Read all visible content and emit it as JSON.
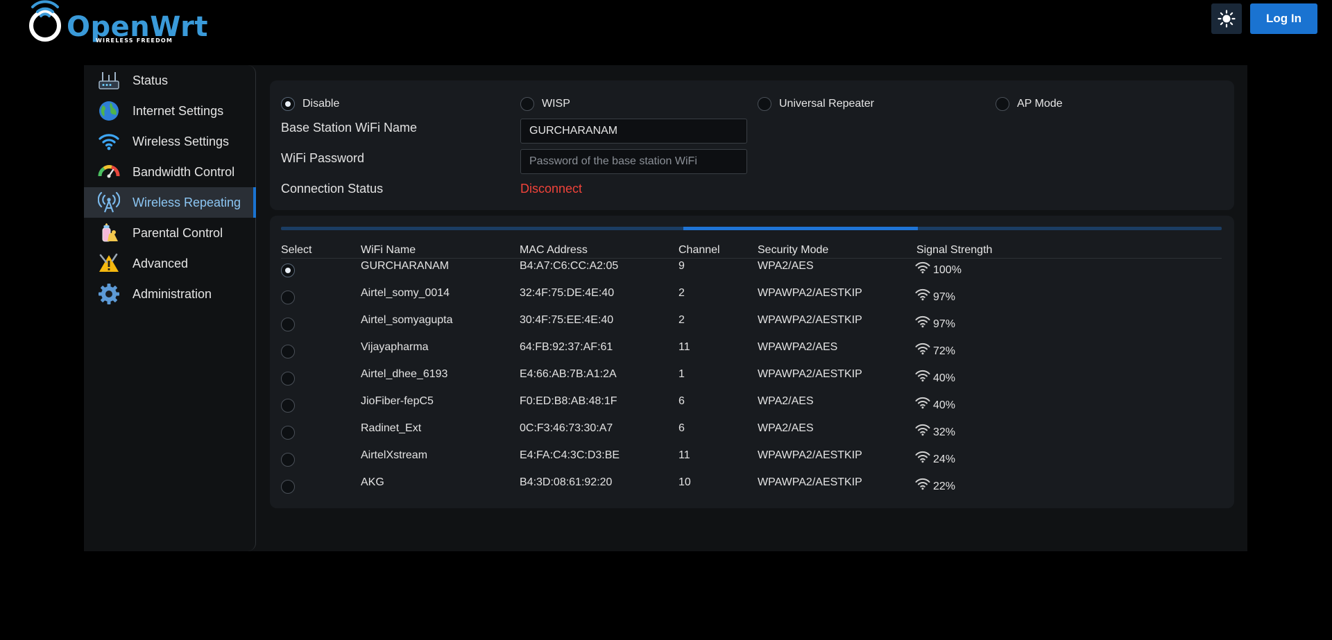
{
  "header": {
    "logo_text": "OpenWrt",
    "logo_tagline": "WIRELESS FREEDOM",
    "theme_icon": "sun-icon",
    "login_label": "Log In"
  },
  "colors": {
    "accent": "#1a73d1",
    "logo": "#3a9ad9",
    "error": "#f0433a",
    "active_nav_text": "#8cc6f3"
  },
  "sidebar": {
    "items": [
      {
        "label": "Status",
        "icon": "router-icon"
      },
      {
        "label": "Internet Settings",
        "icon": "globe-icon"
      },
      {
        "label": "Wireless Settings",
        "icon": "wifi-icon"
      },
      {
        "label": "Bandwidth Control",
        "icon": "speedometer-icon"
      },
      {
        "label": "Wireless Repeating",
        "icon": "antenna-icon",
        "active": true
      },
      {
        "label": "Parental Control",
        "icon": "baby-bottle-icon"
      },
      {
        "label": "Advanced",
        "icon": "warning-tools-icon"
      },
      {
        "label": "Administration",
        "icon": "gear-icon"
      }
    ]
  },
  "modes": {
    "selected": "Disable",
    "options": [
      "Disable",
      "WISP",
      "Universal Repeater",
      "AP Mode"
    ]
  },
  "form": {
    "ssid_label": "Base Station WiFi Name",
    "ssid_value": "GURCHARANAM",
    "password_label": "WiFi Password",
    "password_value": "",
    "password_placeholder": "Password of the base station WiFi",
    "status_label": "Connection Status",
    "status_value": "Disconnect"
  },
  "scan": {
    "progress_start": 0.428,
    "progress_end": 0.677
  },
  "table": {
    "headers": [
      "Select",
      "WiFi Name",
      "MAC Address",
      "Channel",
      "Security Mode",
      "Signal Strength"
    ],
    "rows": [
      {
        "selected": true,
        "ssid": "GURCHARANAM",
        "mac": "B4:A7:C6:CC:A2:05",
        "channel": "9",
        "security": "WPA2/AES",
        "signal": "100%"
      },
      {
        "selected": false,
        "ssid": "Airtel_somy_0014",
        "mac": "32:4F:75:DE:4E:40",
        "channel": "2",
        "security": "WPAWPA2/AESTKIP",
        "signal": "97%"
      },
      {
        "selected": false,
        "ssid": "Airtel_somyagupta",
        "mac": "30:4F:75:EE:4E:40",
        "channel": "2",
        "security": "WPAWPA2/AESTKIP",
        "signal": "97%"
      },
      {
        "selected": false,
        "ssid": "Vijayapharma",
        "mac": "64:FB:92:37:AF:61",
        "channel": "11",
        "security": "WPAWPA2/AES",
        "signal": "72%"
      },
      {
        "selected": false,
        "ssid": "Airtel_dhee_6193",
        "mac": "E4:66:AB:7B:A1:2A",
        "channel": "1",
        "security": "WPAWPA2/AESTKIP",
        "signal": "40%"
      },
      {
        "selected": false,
        "ssid": "JioFiber-fepC5",
        "mac": "F0:ED:B8:AB:48:1F",
        "channel": "6",
        "security": "WPA2/AES",
        "signal": "40%"
      },
      {
        "selected": false,
        "ssid": "Radinet_Ext",
        "mac": "0C:F3:46:73:30:A7",
        "channel": "6",
        "security": "WPA2/AES",
        "signal": "32%"
      },
      {
        "selected": false,
        "ssid": "AirtelXstream",
        "mac": "E4:FA:C4:3C:D3:BE",
        "channel": "11",
        "security": "WPAWPA2/AESTKIP",
        "signal": "24%"
      },
      {
        "selected": false,
        "ssid": "AKG",
        "mac": "B4:3D:08:61:92:20",
        "channel": "10",
        "security": "WPAWPA2/AESTKIP",
        "signal": "22%"
      }
    ]
  }
}
